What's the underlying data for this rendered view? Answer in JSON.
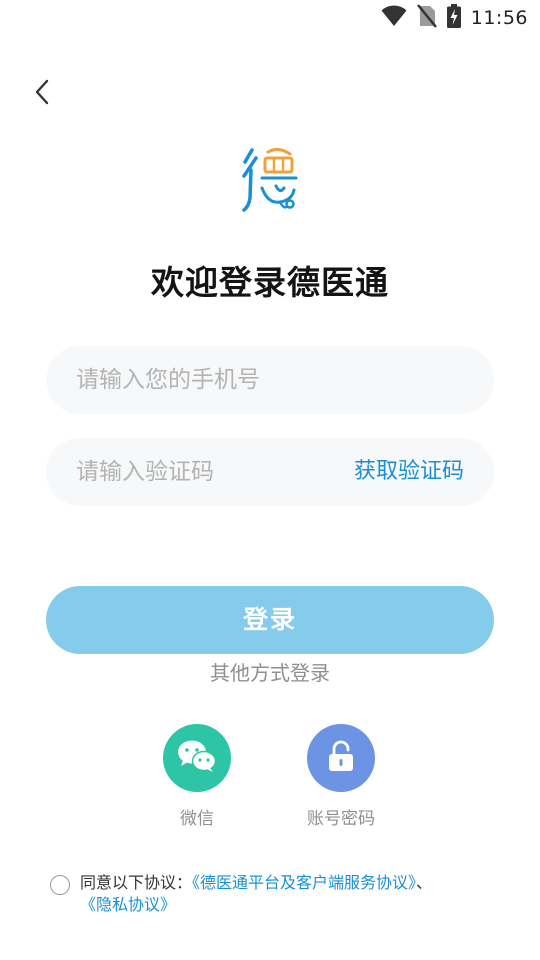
{
  "status_bar": {
    "time": "11:56",
    "icons": [
      "wifi-icon",
      "no-sim-icon",
      "battery-charging-icon"
    ]
  },
  "header": {
    "back_icon": "chevron-left-icon"
  },
  "logo": {
    "name": "deyitong-logo",
    "colors": [
      "#1a8fd6",
      "#f0a23a"
    ]
  },
  "title": "欢迎登录德医通",
  "phone_input": {
    "placeholder": "请输入您的手机号",
    "value": ""
  },
  "code_input": {
    "placeholder": "请输入验证码",
    "value": ""
  },
  "get_code_label": "获取验证码",
  "login_label": "登录",
  "other_methods_label": "其他方式登录",
  "methods": [
    {
      "label": "微信",
      "icon": "wechat-icon",
      "color": "#2dc5a6"
    },
    {
      "label": "账号密码",
      "icon": "unlock-icon",
      "color": "#6d94e4"
    }
  ],
  "agreement": {
    "prefix": "同意以下协议：",
    "service_link": "《德医通平台及客户端服务协议》",
    "separator": "、",
    "privacy_link": "《隐私协议》"
  },
  "colors": {
    "accent": "#1a8fd6",
    "login_button": "#84cbec",
    "input_bg": "#f6f8fa"
  }
}
